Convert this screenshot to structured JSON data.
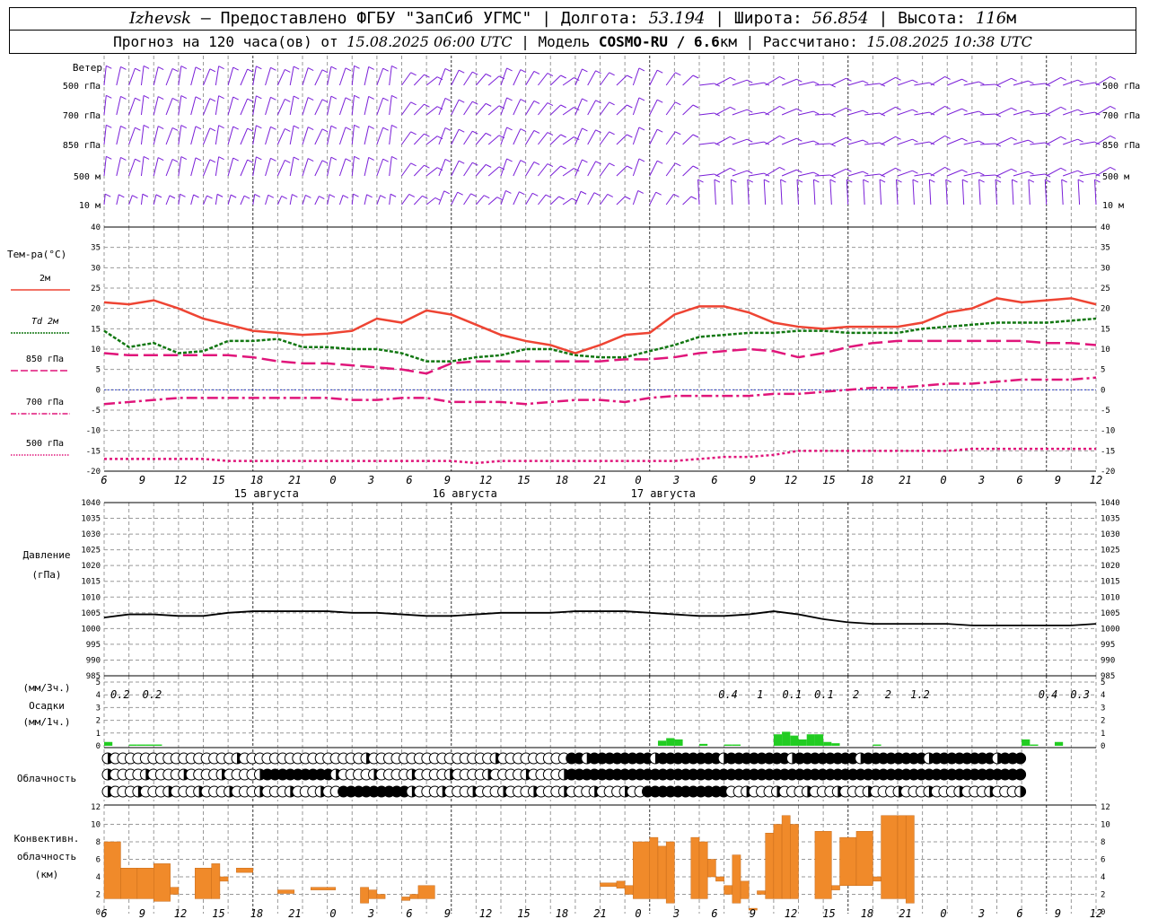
{
  "header": {
    "city": "Izhevsk",
    "provider": " — Предоставлено ФГБУ \"ЗапСиб УГМС\" | Долгота: ",
    "lon": "53.194",
    "lat_label": " | Широта: ",
    "lat": "56.854",
    "alt_label": " | Высота: ",
    "alt": "116",
    "alt_unit": "м",
    "forecast_label": "Прогноз на 120 часа(ов) от ",
    "forecast_start": "15.08.2025 06:00 UTC",
    "model_label": " | Модель ",
    "model": "COSMO-RU / 6.6",
    "model_unit": "км",
    "calc_label": " | Рассчитано: ",
    "calc_time": "15.08.2025 10:38 UTC"
  },
  "labels": {
    "wind": "Ветер",
    "wind_levels": [
      "500 гПа",
      "700 гПа",
      "850 гПа",
      "500 м",
      "10 м"
    ],
    "temp_title": "Тем-ра(°C)",
    "temp_series": [
      "2м",
      "Td 2м",
      "850 гПа",
      "700 гПа",
      "500 гПа"
    ],
    "pressure_title": [
      "Давление",
      "(гПа)"
    ],
    "precip_title": [
      "(мм/3ч.)",
      "Осадки",
      "(мм/1ч.)"
    ],
    "cloud_title": "Облачность",
    "conv_title": [
      "Конвективн.",
      "облачность",
      "(км)"
    ]
  },
  "colors": {
    "wind": "#7a1fd8",
    "t2m": "#ee4433",
    "td2m": "#117711",
    "t850": "#e0157a",
    "t700": "#e0157a",
    "t500": "#e0157a",
    "pressure": "#000000",
    "precip": "#22cc22",
    "conv": "#f08a2a",
    "zero_line": "#3344cc",
    "grid": "#999999"
  },
  "time_axis": {
    "hour_ticks": [
      "6",
      "9",
      "12",
      "15",
      "18",
      "21",
      "0",
      "3",
      "6",
      "9",
      "12",
      "15",
      "18",
      "21",
      "0",
      "3",
      "6",
      "9",
      "12",
      "15",
      "18",
      "21",
      "0",
      "3",
      "6",
      "9",
      "12"
    ],
    "day_labels": [
      "15 августа",
      "16 августа",
      "17 августа"
    ]
  },
  "chart_data": [
    {
      "type": "line",
      "panel": "temperature",
      "xlabel": "",
      "ylabel": "",
      "x_hours": [
        0,
        3,
        6,
        9,
        12,
        15,
        18,
        21,
        24,
        27,
        30,
        33,
        36,
        39,
        42,
        45,
        48,
        51,
        54,
        57,
        60,
        63,
        66,
        69,
        72,
        75,
        78,
        81,
        84,
        87,
        90,
        93,
        96,
        99,
        102,
        105,
        108,
        111,
        114,
        117,
        120
      ],
      "ylim": [
        -20,
        40
      ],
      "yticks": [
        -20,
        -15,
        -10,
        -5,
        0,
        5,
        10,
        15,
        20,
        25,
        30,
        35,
        40
      ],
      "series": [
        {
          "name": "2м",
          "values": [
            21.5,
            21,
            22,
            20,
            17.5,
            16,
            14.5,
            14,
            13.5,
            13.8,
            14.5,
            17.5,
            16.5,
            19.5,
            18.5,
            16,
            13.5,
            12,
            11,
            9,
            11,
            13.5,
            14,
            18.5,
            20.5,
            20.5,
            19,
            16.5,
            15.5,
            15,
            15.5,
            15.5,
            15.5,
            16.5,
            19,
            20,
            22.5,
            21.5,
            22,
            22.5,
            21
          ]
        },
        {
          "name": "Td 2м",
          "values": [
            14.5,
            10.5,
            11.5,
            9,
            9.5,
            12,
            12,
            12.5,
            10.5,
            10.5,
            10,
            10,
            9,
            7,
            7,
            8,
            8.5,
            10,
            10,
            8.5,
            8,
            8,
            9.5,
            11,
            13,
            13.5,
            14,
            14,
            14.5,
            14.5,
            14,
            14,
            14,
            15,
            15.5,
            16,
            16.5,
            16.5,
            16.5,
            17,
            17.5
          ]
        },
        {
          "name": "850 гПа",
          "values": [
            9,
            8.5,
            8.5,
            8.5,
            8.5,
            8.5,
            8,
            7,
            6.5,
            6.5,
            6,
            5.5,
            5,
            4,
            6.5,
            7,
            7,
            7,
            7,
            7,
            7,
            7.5,
            7.5,
            8,
            9,
            9.5,
            10,
            9.5,
            8,
            9,
            10.5,
            11.5,
            12,
            12,
            12,
            12,
            12,
            12,
            11.5,
            11.5,
            11
          ]
        },
        {
          "name": "700 гПа",
          "values": [
            -3.5,
            -3,
            -2.5,
            -2,
            -2,
            -2,
            -2,
            -2,
            -2,
            -2,
            -2.5,
            -2.5,
            -2,
            -2,
            -3,
            -3,
            -3,
            -3.5,
            -3,
            -2.5,
            -2.5,
            -3,
            -2,
            -1.5,
            -1.5,
            -1.5,
            -1.5,
            -1,
            -1,
            -0.5,
            0,
            0.5,
            0.5,
            1,
            1.5,
            1.5,
            2,
            2.5,
            2.5,
            2.5,
            3
          ]
        },
        {
          "name": "500 гПа",
          "values": [
            -17,
            -17,
            -17,
            -17,
            -17,
            -17.5,
            -17.5,
            -17.5,
            -17.5,
            -17.5,
            -17.5,
            -17.5,
            -17.5,
            -17.5,
            -17.5,
            -18,
            -17.5,
            -17.5,
            -17.5,
            -17.5,
            -17.5,
            -17.5,
            -17.5,
            -17.5,
            -17,
            -16.5,
            -16.5,
            -16,
            -15,
            -15,
            -15,
            -15,
            -15,
            -15,
            -15,
            -14.5,
            -14.5,
            -14.5,
            -14.5,
            -14.5,
            -14.5
          ]
        }
      ]
    },
    {
      "type": "line",
      "panel": "pressure",
      "x_hours": [
        0,
        3,
        6,
        9,
        12,
        15,
        18,
        21,
        24,
        27,
        30,
        33,
        36,
        39,
        42,
        45,
        48,
        51,
        54,
        57,
        60,
        63,
        66,
        69,
        72,
        75,
        78,
        81,
        84,
        87,
        90,
        93,
        96,
        99,
        102,
        105,
        108,
        111,
        114,
        117,
        120
      ],
      "ylim": [
        985,
        1040
      ],
      "yticks": [
        985,
        990,
        995,
        1000,
        1005,
        1010,
        1015,
        1020,
        1025,
        1030,
        1035,
        1040
      ],
      "series": [
        {
          "name": "",
          "values": [
            1003.5,
            1004.5,
            1004.5,
            1004,
            1004,
            1005,
            1005.5,
            1005.5,
            1005.5,
            1005.5,
            1005,
            1005,
            1004.5,
            1004,
            1004,
            1004.5,
            1005,
            1005,
            1005,
            1005.5,
            1005.5,
            1005.5,
            1005,
            1004.5,
            1004,
            1004,
            1004.5,
            1005.5,
            1004.5,
            1003,
            1002,
            1001.5,
            1001.5,
            1001.5,
            1001.5,
            1001,
            1001,
            1001,
            1001,
            1001,
            1001.5
          ]
        }
      ]
    },
    {
      "type": "bar",
      "panel": "precipitation",
      "ylim": [
        0,
        5
      ],
      "yticks": [
        0,
        1,
        2,
        3,
        4,
        5
      ],
      "hourly_bars": [
        {
          "h": 0,
          "v": 0.3
        },
        {
          "h": 3,
          "v": 0.1
        },
        {
          "h": 4,
          "v": 0.1
        },
        {
          "h": 5,
          "v": 0.1
        },
        {
          "h": 6,
          "v": 0.1
        },
        {
          "h": 67,
          "v": 0.4
        },
        {
          "h": 68,
          "v": 0.6
        },
        {
          "h": 69,
          "v": 0.5
        },
        {
          "h": 72,
          "v": 0.15
        },
        {
          "h": 75,
          "v": 0.1
        },
        {
          "h": 76,
          "v": 0.1
        },
        {
          "h": 81,
          "v": 0.9
        },
        {
          "h": 82,
          "v": 1.1
        },
        {
          "h": 83,
          "v": 0.8
        },
        {
          "h": 84,
          "v": 0.5
        },
        {
          "h": 85,
          "v": 0.9
        },
        {
          "h": 86,
          "v": 0.9
        },
        {
          "h": 87,
          "v": 0.3
        },
        {
          "h": 88,
          "v": 0.2
        },
        {
          "h": 93,
          "v": 0.1
        },
        {
          "h": 111,
          "v": 0.5
        },
        {
          "h": 112,
          "v": 0.1
        },
        {
          "h": 115,
          "v": 0.3
        }
      ],
      "three_hour_labels": [
        {
          "h": 1.5,
          "text": "0.2"
        },
        {
          "h": 4.5,
          "text": "0.2"
        },
        {
          "h": 58.5,
          "text": "0.4"
        },
        {
          "h": 61.5,
          "text": "1"
        },
        {
          "h": 64.5,
          "text": "0.1"
        },
        {
          "h": 67.5,
          "text": "0.1"
        },
        {
          "h": 70.5,
          "text": "2"
        },
        {
          "h": 73.5,
          "text": "2"
        },
        {
          "h": 76.5,
          "text": "1.2"
        },
        {
          "h": 88.5,
          "text": "0.4"
        },
        {
          "h": 91.5,
          "text": "0.3"
        }
      ]
    },
    {
      "type": "bar",
      "panel": "convective_cloud",
      "ylim": [
        0,
        12
      ],
      "yticks": [
        0,
        2,
        4,
        6,
        8,
        10,
        12
      ],
      "segments": [
        {
          "h0": 0,
          "h1": 2,
          "bottom": 1.5,
          "top": 8
        },
        {
          "h0": 2,
          "h1": 4,
          "bottom": 1.5,
          "top": 5
        },
        {
          "h0": 4,
          "h1": 6,
          "bottom": 1.5,
          "top": 5
        },
        {
          "h0": 6,
          "h1": 8,
          "bottom": 1.2,
          "top": 5.5
        },
        {
          "h0": 8,
          "h1": 9,
          "bottom": 2,
          "top": 2.8
        },
        {
          "h0": 11,
          "h1": 13,
          "bottom": 1.5,
          "top": 5
        },
        {
          "h0": 13,
          "h1": 14,
          "bottom": 1.5,
          "top": 5.5
        },
        {
          "h0": 14,
          "h1": 15,
          "bottom": 3.5,
          "top": 4
        },
        {
          "h0": 16,
          "h1": 18,
          "bottom": 4.5,
          "top": 5
        },
        {
          "h0": 21,
          "h1": 23,
          "bottom": 2.1,
          "top": 2.5
        },
        {
          "h0": 25,
          "h1": 28,
          "bottom": 2.5,
          "top": 2.8
        },
        {
          "h0": 31,
          "h1": 32,
          "bottom": 1,
          "top": 2.8
        },
        {
          "h0": 32,
          "h1": 33,
          "bottom": 1.5,
          "top": 2.5
        },
        {
          "h0": 33,
          "h1": 34,
          "bottom": 1.5,
          "top": 2
        },
        {
          "h0": 36,
          "h1": 37,
          "bottom": 1.3,
          "top": 1.7
        },
        {
          "h0": 37,
          "h1": 38,
          "bottom": 1.5,
          "top": 2
        },
        {
          "h0": 38,
          "h1": 40,
          "bottom": 1.5,
          "top": 3
        },
        {
          "h0": 60,
          "h1": 62,
          "bottom": 2.9,
          "top": 3.3
        },
        {
          "h0": 62,
          "h1": 63,
          "bottom": 2.7,
          "top": 3.5
        },
        {
          "h0": 63,
          "h1": 64,
          "bottom": 2,
          "top": 3
        },
        {
          "h0": 64,
          "h1": 66,
          "bottom": 1.5,
          "top": 8
        },
        {
          "h0": 66,
          "h1": 67,
          "bottom": 1.5,
          "top": 8.5
        },
        {
          "h0": 67,
          "h1": 68,
          "bottom": 1.5,
          "top": 7.5
        },
        {
          "h0": 68,
          "h1": 69,
          "bottom": 1,
          "top": 8
        },
        {
          "h0": 71,
          "h1": 72,
          "bottom": 1.5,
          "top": 8.5
        },
        {
          "h0": 72,
          "h1": 73,
          "bottom": 1.5,
          "top": 8
        },
        {
          "h0": 73,
          "h1": 74,
          "bottom": 4,
          "top": 6
        },
        {
          "h0": 74,
          "h1": 75,
          "bottom": 3.5,
          "top": 4
        },
        {
          "h0": 75,
          "h1": 76,
          "bottom": 2,
          "top": 3
        },
        {
          "h0": 76,
          "h1": 77,
          "bottom": 1,
          "top": 6.5
        },
        {
          "h0": 77,
          "h1": 78,
          "bottom": 1.5,
          "top": 3.5
        },
        {
          "h0": 78,
          "h1": 79,
          "bottom": 0.2,
          "top": 0.4
        },
        {
          "h0": 79,
          "h1": 80,
          "bottom": 2,
          "top": 2.4
        },
        {
          "h0": 80,
          "h1": 81,
          "bottom": 1.5,
          "top": 9
        },
        {
          "h0": 81,
          "h1": 82,
          "bottom": 1.5,
          "top": 10
        },
        {
          "h0": 82,
          "h1": 83,
          "bottom": 1.5,
          "top": 11
        },
        {
          "h0": 83,
          "h1": 84,
          "bottom": 1.5,
          "top": 10
        },
        {
          "h0": 86,
          "h1": 88,
          "bottom": 1.5,
          "top": 9.2
        },
        {
          "h0": 88,
          "h1": 89,
          "bottom": 2.5,
          "top": 3
        },
        {
          "h0": 89,
          "h1": 91,
          "bottom": 3,
          "top": 8.5
        },
        {
          "h0": 91,
          "h1": 93,
          "bottom": 3,
          "top": 9.2
        },
        {
          "h0": 93,
          "h1": 94,
          "bottom": 3.5,
          "top": 4
        },
        {
          "h0": 94,
          "h1": 96,
          "bottom": 1.5,
          "top": 11
        },
        {
          "h0": 96,
          "h1": 97,
          "bottom": 1.5,
          "top": 11
        },
        {
          "h0": 97,
          "h1": 98,
          "bottom": 1,
          "top": 11
        }
      ]
    }
  ]
}
